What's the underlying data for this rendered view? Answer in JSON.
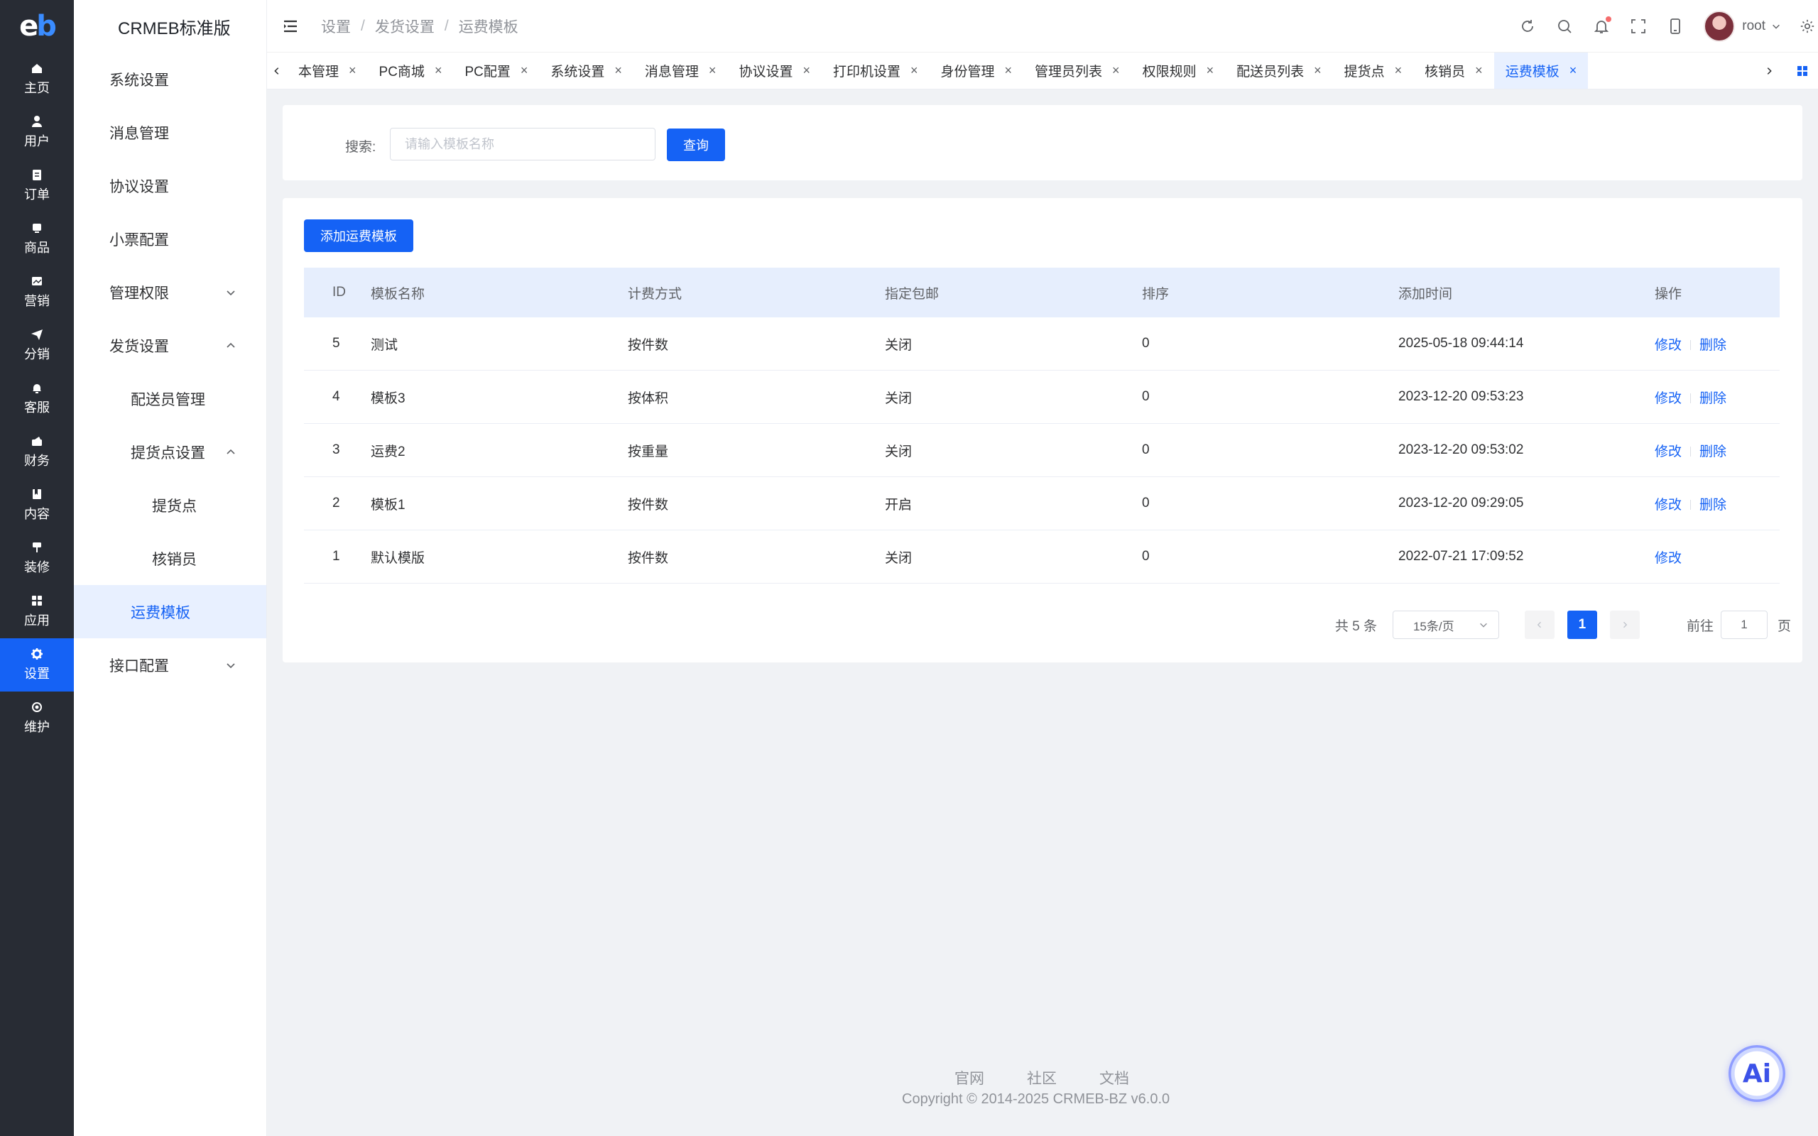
{
  "rail": {
    "items": [
      {
        "label": "主页",
        "icon": "home-icon"
      },
      {
        "label": "用户",
        "icon": "user-icon"
      },
      {
        "label": "订单",
        "icon": "order-icon"
      },
      {
        "label": "商品",
        "icon": "product-icon"
      },
      {
        "label": "营销",
        "icon": "marketing-icon"
      },
      {
        "label": "分销",
        "icon": "distribution-icon"
      },
      {
        "label": "客服",
        "icon": "service-icon"
      },
      {
        "label": "财务",
        "icon": "finance-icon"
      },
      {
        "label": "内容",
        "icon": "content-icon"
      },
      {
        "label": "装修",
        "icon": "decorate-icon"
      },
      {
        "label": "应用",
        "icon": "apps-icon"
      },
      {
        "label": "设置",
        "icon": "settings-icon"
      },
      {
        "label": "维护",
        "icon": "maintenance-icon"
      }
    ],
    "active_index": 11
  },
  "submenu": {
    "brand": "CRMEB标准版",
    "items": [
      {
        "label": "系统设置"
      },
      {
        "label": "消息管理"
      },
      {
        "label": "协议设置"
      },
      {
        "label": "小票配置"
      },
      {
        "label": "管理权限"
      },
      {
        "label": "发货设置"
      },
      {
        "label": "配送员管理"
      },
      {
        "label": "提货点设置"
      },
      {
        "label": "提货点"
      },
      {
        "label": "核销员"
      },
      {
        "label": "运费模板"
      },
      {
        "label": "接口配置"
      }
    ]
  },
  "header": {
    "breadcrumb": [
      "设置",
      "发货设置",
      "运费模板"
    ],
    "user": "root"
  },
  "tabs": [
    {
      "label": "本管理"
    },
    {
      "label": "PC商城"
    },
    {
      "label": "PC配置"
    },
    {
      "label": "系统设置"
    },
    {
      "label": "消息管理"
    },
    {
      "label": "协议设置"
    },
    {
      "label": "打印机设置"
    },
    {
      "label": "身份管理"
    },
    {
      "label": "管理员列表"
    },
    {
      "label": "权限规则"
    },
    {
      "label": "配送员列表"
    },
    {
      "label": "提货点"
    },
    {
      "label": "核销员"
    },
    {
      "label": "运费模板"
    }
  ],
  "search": {
    "label": "搜索:",
    "placeholder": "请输入模板名称",
    "button": "查询"
  },
  "table": {
    "add_button": "添加运费模板",
    "columns": [
      "ID",
      "模板名称",
      "计费方式",
      "指定包邮",
      "排序",
      "添加时间",
      "操作"
    ],
    "rows": [
      {
        "id": "5",
        "name": "测试",
        "method": "按件数",
        "free": "关闭",
        "sort": "0",
        "time": "2025-05-18 09:44:14",
        "edit": "修改",
        "delete": "删除"
      },
      {
        "id": "4",
        "name": "模板3",
        "method": "按体积",
        "free": "关闭",
        "sort": "0",
        "time": "2023-12-20 09:53:23",
        "edit": "修改",
        "delete": "删除"
      },
      {
        "id": "3",
        "name": "运费2",
        "method": "按重量",
        "free": "关闭",
        "sort": "0",
        "time": "2023-12-20 09:53:02",
        "edit": "修改",
        "delete": "删除"
      },
      {
        "id": "2",
        "name": "模板1",
        "method": "按件数",
        "free": "开启",
        "sort": "0",
        "time": "2023-12-20 09:29:05",
        "edit": "修改",
        "delete": "删除"
      },
      {
        "id": "1",
        "name": "默认模版",
        "method": "按件数",
        "free": "关闭",
        "sort": "0",
        "time": "2022-07-21 17:09:52",
        "edit": "修改",
        "delete": ""
      }
    ]
  },
  "pagination": {
    "total": "共 5 条",
    "page_size": "15条/页",
    "current": "1",
    "goto_label": "前往",
    "goto_value": "1",
    "page_unit": "页"
  },
  "footer": {
    "links": [
      "官网",
      "社区",
      "文档"
    ],
    "copyright": "Copyright © 2014-2025 CRMEB-BZ v6.0.0"
  },
  "fab": {
    "label": "Ai"
  },
  "colors": {
    "primary": "#1562f5",
    "rail_bg": "#282c34",
    "active_bg": "#e8f0ff"
  }
}
